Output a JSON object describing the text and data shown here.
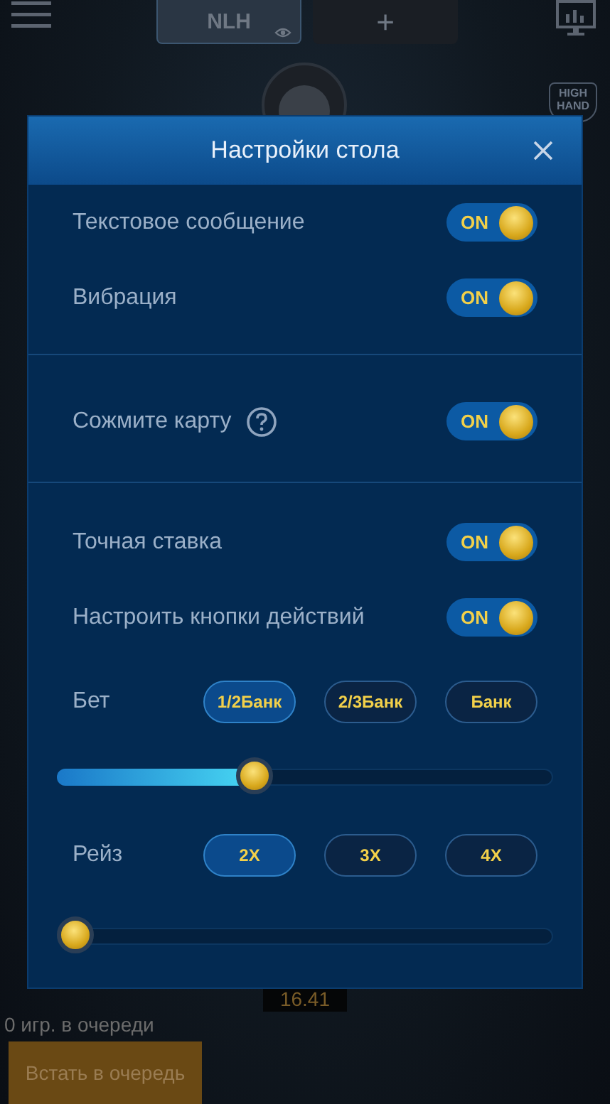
{
  "top_bar": {
    "tabs": [
      {
        "label": "NLH",
        "selected": true
      },
      {
        "label": "+",
        "selected": false
      }
    ]
  },
  "high_hand_badge": [
    "HIGH",
    "HAND"
  ],
  "pot": "16.41",
  "queue_text": "0 игр. в очереди",
  "join_button": "Встать в очередь",
  "dialog": {
    "title": "Настройки стола",
    "sections": [
      {
        "rows": [
          {
            "label": "Текстовое сообщение",
            "help": false,
            "on": true,
            "toggle_text": "ON"
          },
          {
            "label": "Вибрация",
            "help": false,
            "on": true,
            "toggle_text": "ON"
          }
        ]
      },
      {
        "rows": [
          {
            "label": "Сожмите карту",
            "help": true,
            "on": true,
            "toggle_text": "ON"
          }
        ]
      },
      {
        "rows": [
          {
            "label": "Точная ставка",
            "help": false,
            "on": true,
            "toggle_text": "ON"
          },
          {
            "label": "Настроить кнопки действий",
            "help": false,
            "on": true,
            "toggle_text": "ON"
          }
        ]
      }
    ],
    "presets": [
      {
        "label": "Бет",
        "options": [
          {
            "label": "1/2Банк",
            "selected": true
          },
          {
            "label": "2/3Банк",
            "selected": false
          },
          {
            "label": "Банк",
            "selected": false
          }
        ],
        "slider": {
          "level": 0.39
        }
      },
      {
        "label": "Рейз",
        "options": [
          {
            "label": "2X",
            "selected": true
          },
          {
            "label": "3X",
            "selected": false
          },
          {
            "label": "4X",
            "selected": false
          }
        ],
        "slider": {
          "level": 0
        }
      }
    ]
  }
}
